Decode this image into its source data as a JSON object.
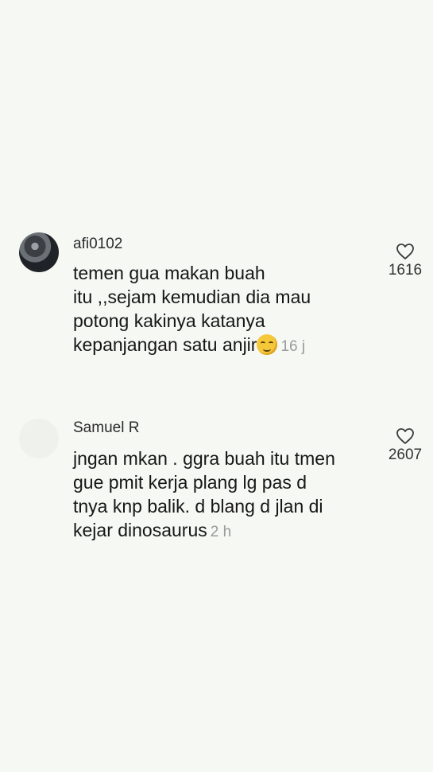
{
  "comments": [
    {
      "username": "afi0102",
      "lines": [
        "temen gua makan buah",
        "itu ,,sejam kemudian dia mau",
        "potong kakinya katanya",
        "kepanjangan satu anjir"
      ],
      "emoji": "grinning-face-emoji",
      "time": "16 j",
      "like_count": "1616",
      "like_icon": "heart-outline-icon"
    },
    {
      "username": "Samuel R",
      "lines": [
        "jngan mkan . ggra buah itu tmen",
        "gue pmit kerja plang lg pas d",
        "tnya knp balik. d blang d jlan di",
        "kejar dinosaurus"
      ],
      "time": "2 h",
      "like_count": "2607",
      "like_icon": "heart-outline-icon"
    }
  ]
}
